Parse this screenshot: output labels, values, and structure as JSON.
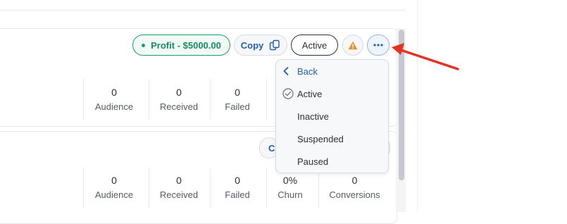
{
  "card1": {
    "profit_label": "Profit - $5000.00",
    "copy_label": "Copy",
    "status_label": "Active",
    "stats": [
      {
        "value": "0",
        "label": "Audience"
      },
      {
        "value": "0",
        "label": "Received"
      },
      {
        "value": "0",
        "label": "Failed"
      }
    ]
  },
  "card2": {
    "partial_button_label": "C",
    "stats": [
      {
        "value": "0",
        "label": "Audience"
      },
      {
        "value": "0",
        "label": "Received"
      },
      {
        "value": "0",
        "label": "Failed"
      },
      {
        "value": "0%",
        "label": "Churn"
      },
      {
        "value": "0",
        "label": "Conversions"
      }
    ]
  },
  "status_menu": {
    "back_label": "Back",
    "items": [
      {
        "label": "Active",
        "selected": true
      },
      {
        "label": "Inactive",
        "selected": false
      },
      {
        "label": "Suspended",
        "selected": false
      },
      {
        "label": "Paused",
        "selected": false
      }
    ]
  },
  "colors": {
    "accent_blue": "#1f5fa8",
    "profit_green": "#1a9c6b",
    "warning_orange": "#e8922a",
    "annotation_red": "#e53322"
  }
}
